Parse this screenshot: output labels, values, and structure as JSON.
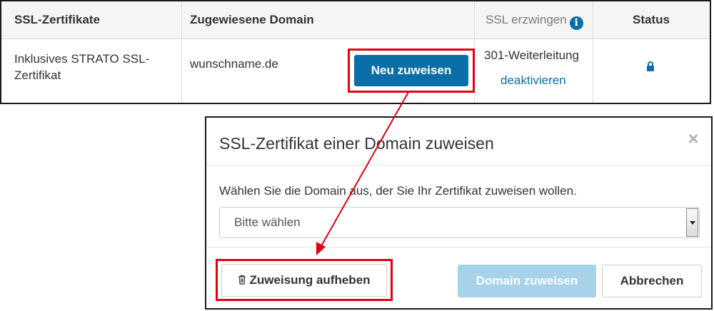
{
  "table": {
    "headers": {
      "certificates": "SSL-Zertifikate",
      "assigned_domain": "Zugewiesene Domain",
      "force_ssl": "SSL erzwingen",
      "status": "Status"
    },
    "row": {
      "certificate": "Inklusives STRATO SSL-Zertifikat",
      "domain": "wunschname.de",
      "reassign_button": "Neu zuweisen",
      "redirect_status": "301-Weiterleitung",
      "deactivate_link": "deaktivieren",
      "status_icon": "lock-icon"
    }
  },
  "modal": {
    "title": "SSL-Zertifikat einer Domain zuweisen",
    "close_icon": "close-icon",
    "instruction": "Wählen Sie die Domain aus, der Sie Ihr Zertifikat zuweisen wollen.",
    "select_value": "Bitte wählen",
    "unassign_button": "Zuweisung aufheben",
    "assign_button": "Domain zuweisen",
    "cancel_button": "Abbrechen"
  },
  "colors": {
    "primary": "#0a6ea8",
    "primary_disabled": "#a8d1ea",
    "annotation_red": "#e3000f"
  }
}
